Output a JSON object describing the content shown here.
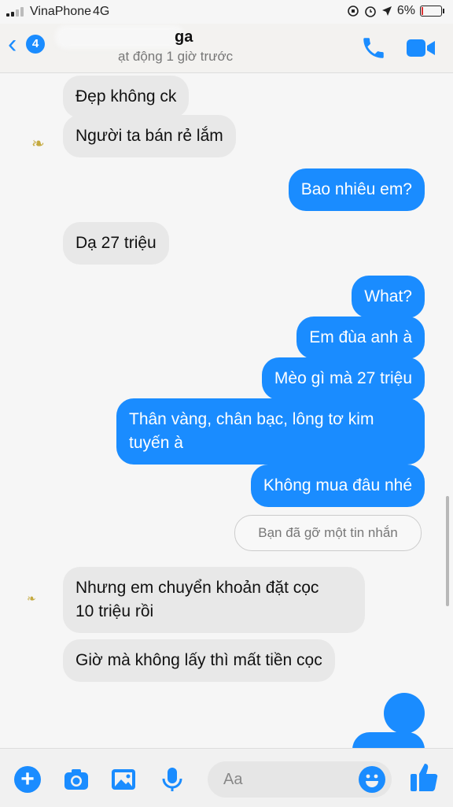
{
  "status_bar": {
    "carrier": "VinaPhone",
    "network": "4G",
    "battery": "6%"
  },
  "header": {
    "unread_count": "4",
    "contact_name": "ga",
    "active_status": "ạt động 1 giờ trước"
  },
  "messages": [
    {
      "direction": "in",
      "text": "Đẹp không ck"
    },
    {
      "direction": "in",
      "text": "Người ta bán rẻ lắm"
    },
    {
      "direction": "out",
      "text": "Bao nhiêu em?"
    },
    {
      "direction": "in",
      "text": "Dạ 27 triệu"
    },
    {
      "direction": "out",
      "text": "What?"
    },
    {
      "direction": "out",
      "text": "Em đùa anh à"
    },
    {
      "direction": "out",
      "text": "Mèo gì mà 27 triệu"
    },
    {
      "direction": "out",
      "text": "Thân vàng, chân bạc, lông tơ kim tuyến à",
      "lines": [
        "Thân vàng, chân bạc, lông tơ kim",
        "tuyến à"
      ]
    },
    {
      "direction": "out",
      "text": "Không mua đâu nhé"
    },
    {
      "direction": "in",
      "text": "Nhưng em chuyển khoản đặt cọc 10 triệu rồi",
      "lines": [
        "Nhưng em chuyển khoản đặt cọc",
        "10 triệu rồi"
      ]
    },
    {
      "direction": "in",
      "text": "Giờ mà không lấy thì mất tiền cọc"
    }
  ],
  "unsent_notice": "Bạn đã gỡ một tin nhắn",
  "composer": {
    "placeholder": "Aa"
  },
  "colors": {
    "accent": "#1a8cff",
    "incoming_bubble": "#e8e8e8"
  }
}
